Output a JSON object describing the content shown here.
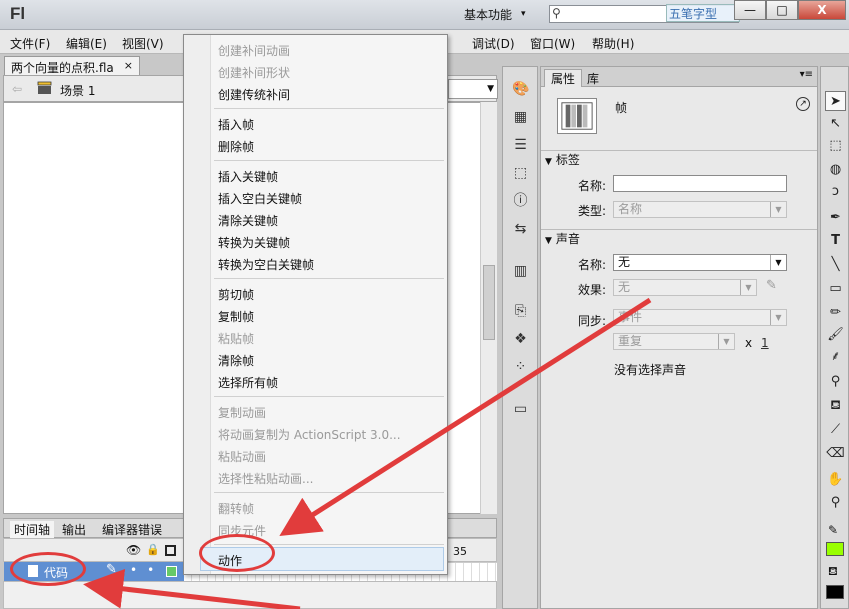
{
  "titlebar": {
    "app_logo": "Fl",
    "workspace": "基本功能",
    "watermark": "五笔字型",
    "min": "—",
    "max": "□",
    "close": "X"
  },
  "menubar": {
    "items": [
      "文件(F)",
      "编辑(E)",
      "视图(V)",
      "调试(D)",
      "窗口(W)",
      "帮助(H)"
    ]
  },
  "document": {
    "tab_title": "两个向量的点积.fla",
    "tab_close": "×",
    "scene": "场景 1"
  },
  "timeline": {
    "tabs": [
      "时间轴",
      "输出",
      "编译器错误"
    ],
    "frame_marker": "35",
    "layer_name": "代码"
  },
  "context_menu": {
    "items": [
      {
        "label": "创建补间动画",
        "enabled": false
      },
      {
        "label": "创建补间形状",
        "enabled": false
      },
      {
        "label": "创建传统补间",
        "enabled": true
      },
      {
        "label": "插入帧",
        "enabled": true
      },
      {
        "label": "删除帧",
        "enabled": true
      },
      {
        "label": "插入关键帧",
        "enabled": true
      },
      {
        "label": "插入空白关键帧",
        "enabled": true
      },
      {
        "label": "清除关键帧",
        "enabled": true
      },
      {
        "label": "转换为关键帧",
        "enabled": true
      },
      {
        "label": "转换为空白关键帧",
        "enabled": true
      },
      {
        "label": "剪切帧",
        "enabled": true
      },
      {
        "label": "复制帧",
        "enabled": true
      },
      {
        "label": "粘贴帧",
        "enabled": false
      },
      {
        "label": "清除帧",
        "enabled": true
      },
      {
        "label": "选择所有帧",
        "enabled": true
      },
      {
        "label": "复制动画",
        "enabled": false
      },
      {
        "label": "将动画复制为 ActionScript 3.0...",
        "enabled": false
      },
      {
        "label": "粘贴动画",
        "enabled": false
      },
      {
        "label": "选择性粘贴动画...",
        "enabled": false
      },
      {
        "label": "翻转帧",
        "enabled": false
      },
      {
        "label": "同步元件",
        "enabled": false
      },
      {
        "label": "动作",
        "enabled": true
      }
    ]
  },
  "properties": {
    "tab_properties": "属性",
    "tab_library": "库",
    "frame_label": "帧",
    "section_label": "标签",
    "name_label": "名称:",
    "name_value": "",
    "type_label": "类型:",
    "type_value": "名称",
    "section_sound": "声音",
    "sound_name_label": "名称:",
    "sound_name_value": "无",
    "effect_label": "效果:",
    "effect_value": "无",
    "sync_label": "同步:",
    "sync_value": "事件",
    "repeat_value": "重复",
    "repeat_x": "x",
    "repeat_count": "1",
    "no_sound": "没有选择声音"
  },
  "colors": {
    "stroke": "#99ff00",
    "fill": "#000000",
    "annotation": "#e13c3c",
    "layer_highlight": "#5f8fd2"
  }
}
